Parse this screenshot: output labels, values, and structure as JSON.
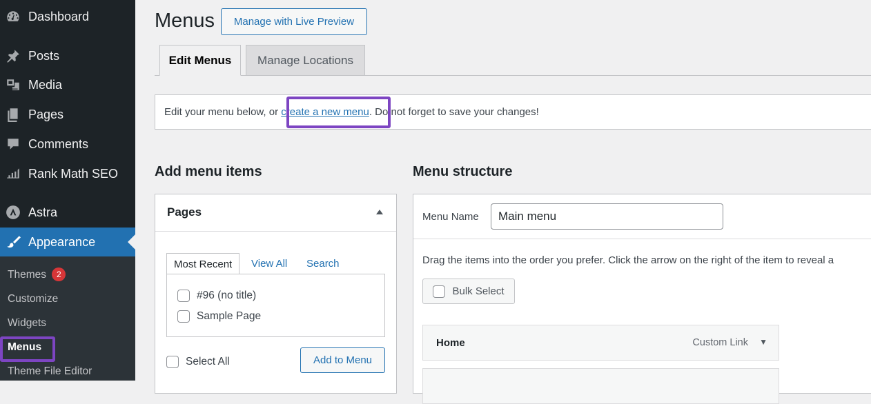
{
  "sidebar": {
    "items": [
      {
        "label": "Dashboard",
        "icon": "dashboard-icon"
      },
      {
        "label": "Posts",
        "icon": "pin-icon"
      },
      {
        "label": "Media",
        "icon": "media-icon"
      },
      {
        "label": "Pages",
        "icon": "pages-icon"
      },
      {
        "label": "Comments",
        "icon": "comment-icon"
      },
      {
        "label": "Rank Math SEO",
        "icon": "chart-icon"
      },
      {
        "label": "Astra",
        "icon": "astra-icon"
      },
      {
        "label": "Appearance",
        "icon": "brush-icon"
      }
    ],
    "submenu": [
      {
        "label": "Themes",
        "badge": "2"
      },
      {
        "label": "Customize"
      },
      {
        "label": "Widgets"
      },
      {
        "label": "Menus"
      },
      {
        "label": "Theme File Editor"
      }
    ]
  },
  "header": {
    "title": "Menus",
    "live_preview_label": "Manage with Live Preview"
  },
  "tabs": [
    {
      "label": "Edit Menus"
    },
    {
      "label": "Manage Locations"
    }
  ],
  "notice": {
    "before": "Edit your menu below, or ",
    "link": "create a new menu",
    "after": ". Do not forget to save your changes!"
  },
  "add_items": {
    "heading": "Add menu items",
    "panel_title": "Pages",
    "tabs": [
      "Most Recent",
      "View All",
      "Search"
    ],
    "pages": [
      "#96 (no title)",
      "Sample Page"
    ],
    "select_all": "Select All",
    "add_button": "Add to Menu"
  },
  "structure": {
    "heading": "Menu structure",
    "menu_name_label": "Menu Name",
    "menu_name_value": "Main menu",
    "instructions": "Drag the items into the order you prefer. Click the arrow on the right of the item to reveal a",
    "bulk_select": "Bulk Select",
    "items": [
      {
        "title": "Home",
        "type": "Custom Link"
      }
    ]
  },
  "colors": {
    "sidebar_bg": "#1d2327",
    "accent": "#2271b1",
    "highlight_box": "#7d45c2",
    "badge": "#d63638"
  }
}
